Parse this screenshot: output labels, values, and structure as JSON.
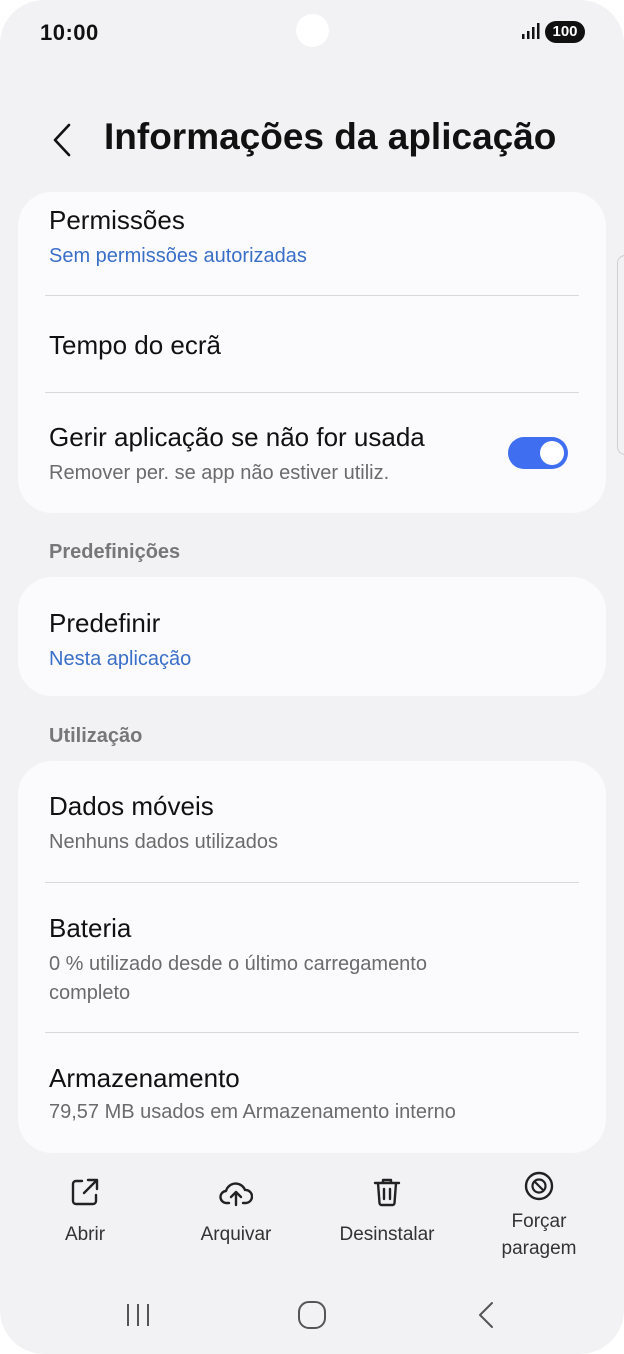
{
  "status_bar": {
    "time": "10:00",
    "battery": "100"
  },
  "header": {
    "title": "Informações da aplicação"
  },
  "card_permissions": {
    "permissions_title": "Permissões",
    "permissions_sub": "Sem permissões autorizadas",
    "screen_time_title": "Tempo do ecrã",
    "manage_title": "Gerir aplicação se não for usada",
    "manage_sub": "Remover per. se app não estiver utiliz.",
    "manage_toggle_on": true
  },
  "section_defaults": {
    "label": "Predefinições",
    "set_default_title": "Predefinir",
    "set_default_sub": "Nesta aplicação"
  },
  "section_usage": {
    "label": "Utilização",
    "mobile_data_title": "Dados móveis",
    "mobile_data_sub": "Nenhuns dados utilizados",
    "battery_title": "Bateria",
    "battery_sub_line1": "0 % utilizado desde o último carregamento",
    "battery_sub_line2": "completo",
    "storage_title": "Armazenamento",
    "storage_sub": "79,57 MB usados em Armazenamento interno"
  },
  "actions": {
    "open": "Abrir",
    "archive": "Arquivar",
    "uninstall": "Desinstalar",
    "force_stop_line1": "Forçar",
    "force_stop_line2": "paragem"
  },
  "nav": {
    "recents_icon": "recents-icon",
    "home_icon": "home-icon",
    "back_icon": "back-icon"
  },
  "colors": {
    "accent": "#3f6ff0",
    "link": "#3a6fc8",
    "background": "#f2f2f4",
    "card": "#fbfbfd"
  }
}
